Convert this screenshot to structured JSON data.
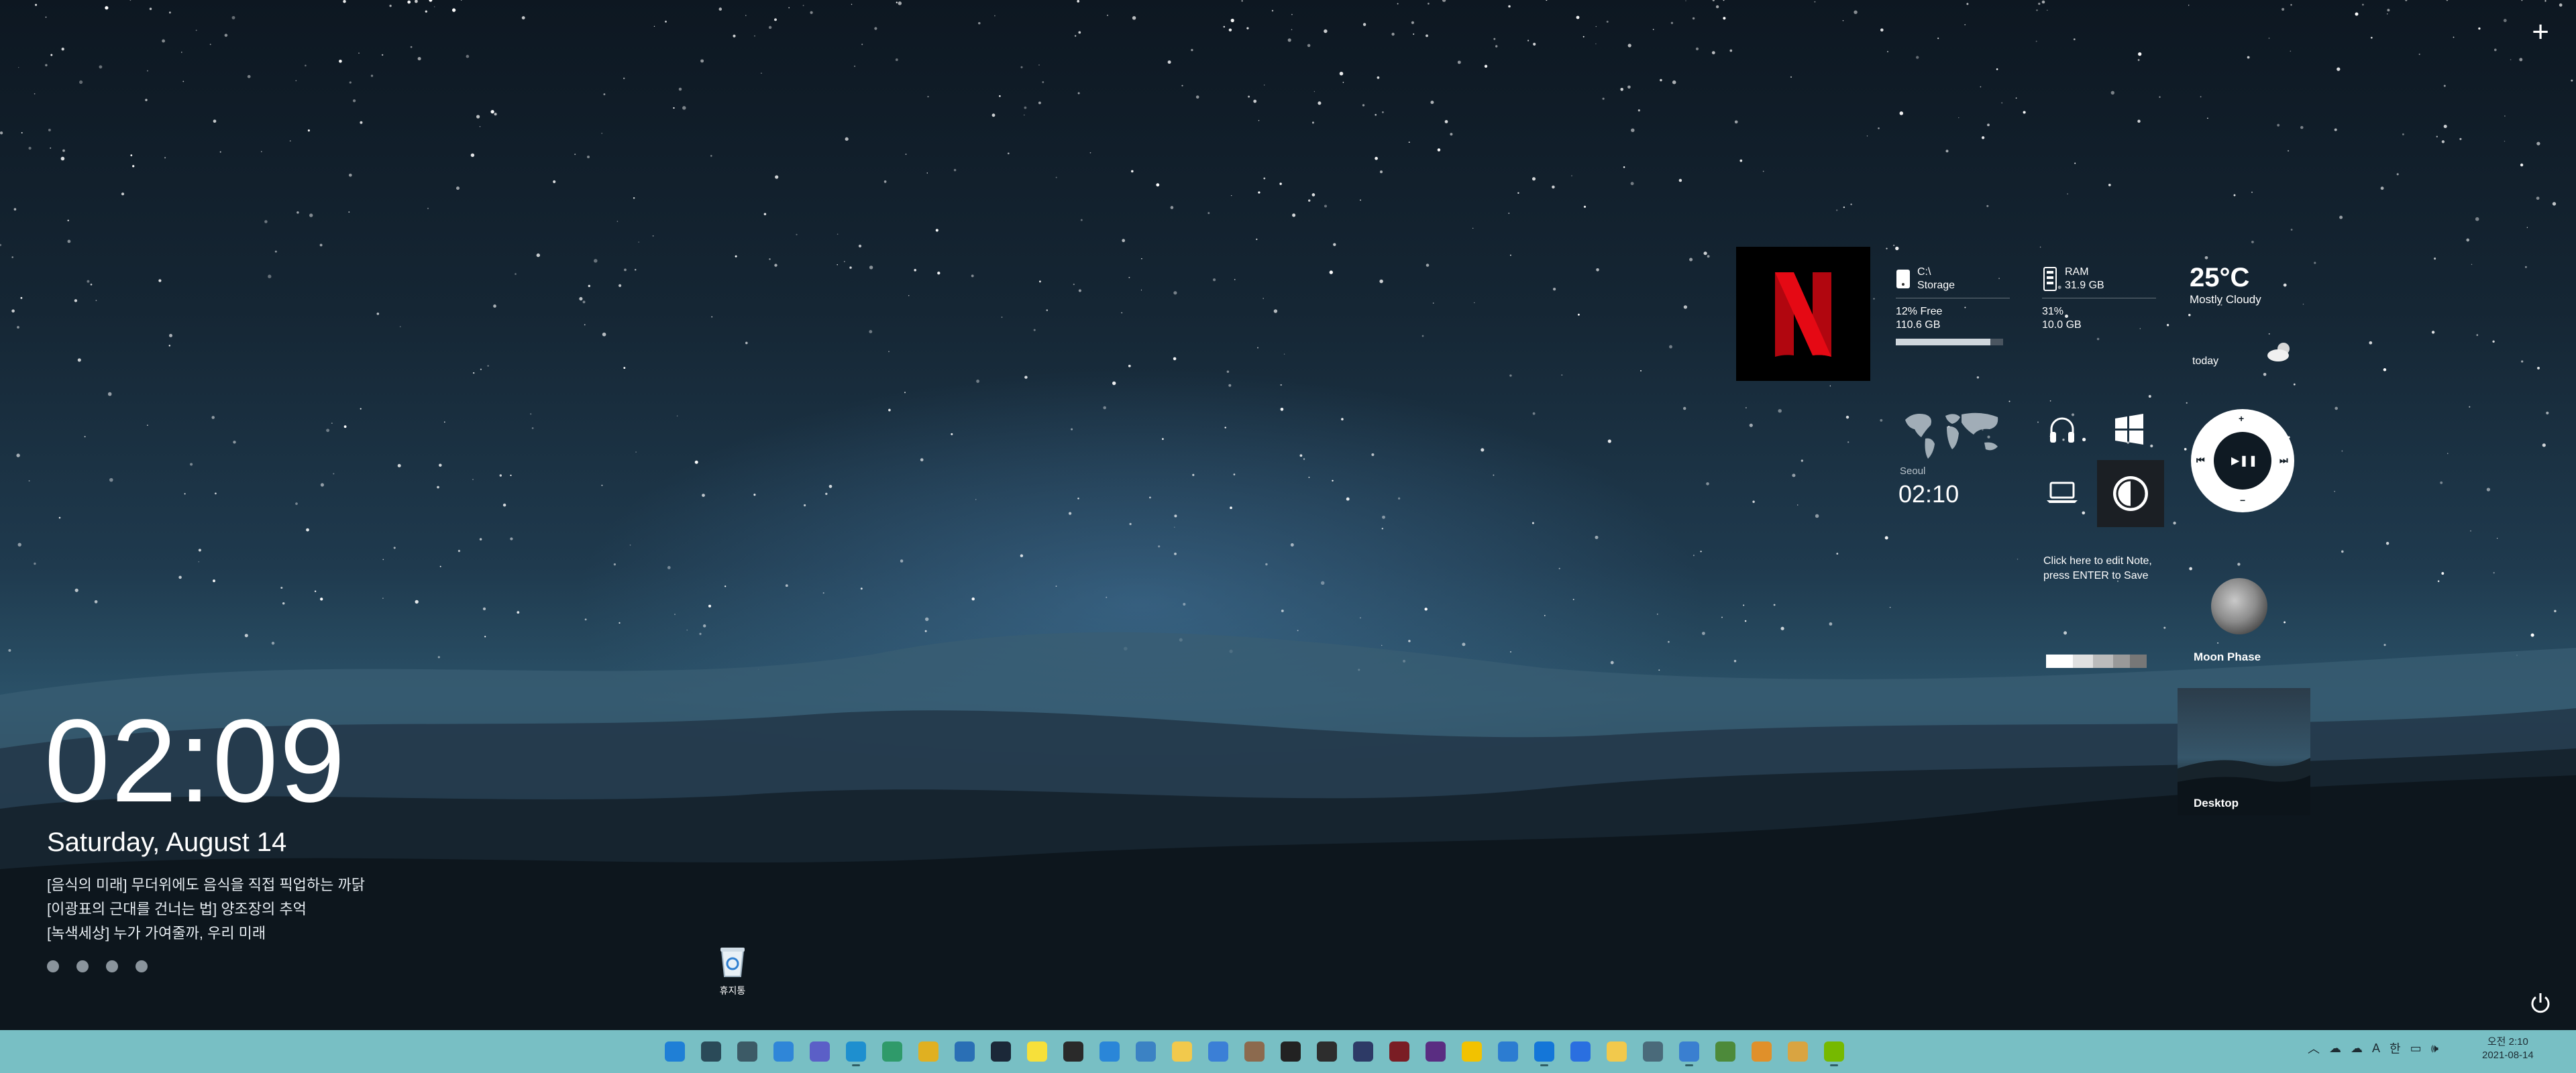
{
  "desktop": {
    "clock_widget": {
      "time": "02:09",
      "date": "Saturday, August 14",
      "news": [
        "[음식의 미래] 무더위에도 음식을 직접 픽업하는 까닭",
        "[이광표의 근대를 건너는 법] 양조장의 추억",
        "[녹색세상] 누가 가여줄까, 우리 미래"
      ]
    },
    "recycle_bin": {
      "label": "휴지통"
    },
    "storage": {
      "drive": "C:\\",
      "title": "Storage",
      "free_pct": "12% Free",
      "free_size": "110.6 GB",
      "used_fraction": 0.88
    },
    "ram": {
      "title": "RAM",
      "total": "31.9 GB",
      "usage_pct": "31%",
      "used": "10.0 GB"
    },
    "weather": {
      "temp": "25°C",
      "condition": "Mostly Cloudy",
      "day": "today"
    },
    "world_clock": {
      "city": "Seoul",
      "time": "02:10"
    },
    "note": {
      "text": "Click here to edit Note, press ENTER to Save"
    },
    "moon": {
      "label": "Moon Phase"
    },
    "desktop_thumb": {
      "label": "Desktop"
    },
    "icons": {
      "plus": "+",
      "netflix": "N"
    }
  },
  "taskbar": {
    "clock_time": "오전 2:10",
    "clock_date": "2021-08-14",
    "ime": "A",
    "ime2": "한",
    "apps": [
      {
        "name": "start",
        "color": "#1f7fd6",
        "running": false
      },
      {
        "name": "search",
        "color": "#2a4a58",
        "running": false
      },
      {
        "name": "task-view",
        "color": "#3c5a66",
        "running": false
      },
      {
        "name": "widgets",
        "color": "#2f86d8",
        "running": false
      },
      {
        "name": "teams",
        "color": "#5b5fc7",
        "running": false
      },
      {
        "name": "edge",
        "color": "#1e8fcf",
        "running": true
      },
      {
        "name": "edge-dev",
        "color": "#2f9a6a",
        "running": false
      },
      {
        "name": "chrome",
        "color": "#e0b021",
        "running": false
      },
      {
        "name": "store",
        "color": "#2a6fb5",
        "running": false
      },
      {
        "name": "steam",
        "color": "#1b2838",
        "running": false
      },
      {
        "name": "kakaotalk",
        "color": "#f7e03a",
        "running": false
      },
      {
        "name": "epic-games",
        "color": "#2a2a2a",
        "running": false
      },
      {
        "name": "app-store",
        "color": "#2a86d8",
        "running": false
      },
      {
        "name": "network",
        "color": "#3b82c4",
        "running": false
      },
      {
        "name": "file-explorer",
        "color": "#f2c94c",
        "running": false
      },
      {
        "name": "mail",
        "color": "#3b7fd6",
        "running": false
      },
      {
        "name": "photos",
        "color": "#8c6a4e",
        "running": false
      },
      {
        "name": "oculus",
        "color": "#222222",
        "running": false
      },
      {
        "name": "openai",
        "color": "#2d2d2d",
        "running": false
      },
      {
        "name": "discord",
        "color": "#2d3a66",
        "running": false
      },
      {
        "name": "valorant",
        "color": "#7a1d24",
        "running": false
      },
      {
        "name": "nexon",
        "color": "#5a2d82",
        "running": false
      },
      {
        "name": "potplayer",
        "color": "#f2c200",
        "running": false
      },
      {
        "name": "calendar",
        "color": "#2c7cd1",
        "running": false
      },
      {
        "name": "teamviewer",
        "color": "#1476d8",
        "running": true
      },
      {
        "name": "messenger",
        "color": "#2a6fe0",
        "running": false
      },
      {
        "name": "kakao-player",
        "color": "#f2c94c",
        "running": false
      },
      {
        "name": "settings",
        "color": "#4a6a7a",
        "running": false
      },
      {
        "name": "browser",
        "color": "#3a7fd0",
        "running": true
      },
      {
        "name": "minecraft",
        "color": "#4d8a3a",
        "running": false
      },
      {
        "name": "app-orange",
        "color": "#e0902a",
        "running": false
      },
      {
        "name": "folder-app",
        "color": "#d9a441",
        "running": false
      },
      {
        "name": "nvidia",
        "color": "#76b900",
        "running": true
      }
    ]
  }
}
